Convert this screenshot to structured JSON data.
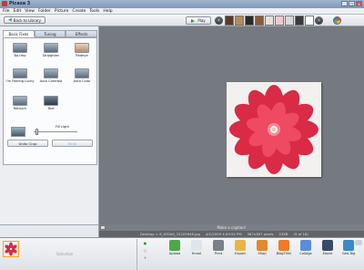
{
  "window": {
    "title": "Picasa 3",
    "buttons": [
      "_",
      "□",
      "x"
    ]
  },
  "menu": [
    "File",
    "Edit",
    "View",
    "Folder",
    "Picture",
    "Create",
    "Tools",
    "Help"
  ],
  "toolbar": {
    "back_label": "Back to Library",
    "play_label": "Play",
    "thumb_colors": [
      "#5a3a2a",
      "#b48a5a",
      "#2a2a2a",
      "#8a5a3a",
      "#e8e0d8",
      "#f2c8d0",
      "#d8d8d8",
      "#3a3a3a",
      "#ffffff"
    ]
  },
  "panel": {
    "tabs": [
      "Basic Fixes",
      "Tuning",
      "Effects"
    ],
    "active_tab": "Basic Fixes",
    "fixes": [
      {
        "label": "Ba.tmp"
      },
      {
        "label": "Straighten"
      },
      {
        "label": "Redeye"
      },
      {
        "label": "I'm Feeling Lucky"
      },
      {
        "label": "Auto Contrast"
      },
      {
        "label": "Auto Color"
      },
      {
        "label": "Retouch"
      },
      {
        "label": "Text"
      }
    ],
    "fill_light": {
      "label": "Fill Light",
      "level": 0.05
    },
    "undo_label": "Undo Crop",
    "redo_label": "Redo"
  },
  "viewer": {
    "caption_placeholder": "Make a caption!",
    "info": {
      "file": "Desktop > 6_635b9_32209946.jpg",
      "date": "4/2/2009 4:09:54 PM",
      "dims": "387x387 pixels",
      "size": "22KB",
      "position": "(9 of 16)"
    }
  },
  "tray": {
    "selection_label": "Selection",
    "hold_buttons": [
      "●",
      "○",
      "+"
    ],
    "actions": [
      {
        "label": "Upload",
        "icon": "upload-icon",
        "color": "#4aa84a"
      },
      {
        "label": "Email",
        "icon": "email-icon",
        "color": "#dfe5ec"
      },
      {
        "label": "Print",
        "icon": "print-icon",
        "color": "#7a8089"
      },
      {
        "label": "Export",
        "icon": "export-icon",
        "color": "#e7b64a"
      },
      {
        "label": "Shop",
        "icon": "shop-icon",
        "color": "#e08a2a"
      },
      {
        "label": "BlogThis!",
        "icon": "blog-icon",
        "color": "#ef7b28"
      },
      {
        "label": "Collage",
        "icon": "collage-icon",
        "color": "#5a8ed8"
      },
      {
        "label": "Movie",
        "icon": "movie-icon",
        "color": "#3a4a66"
      },
      {
        "label": "Geo-Tag",
        "icon": "globe-icon",
        "color": "#3a8ac8"
      }
    ]
  }
}
